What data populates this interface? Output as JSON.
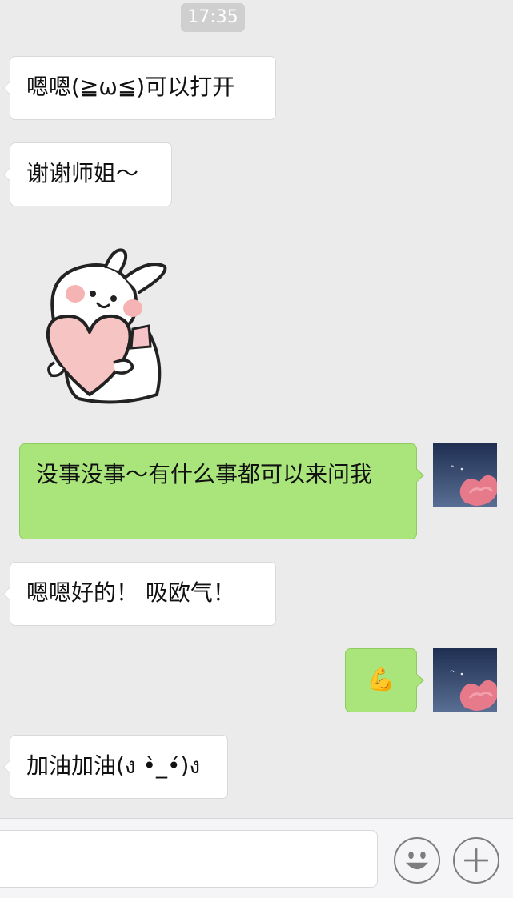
{
  "status": {
    "time": "17:35"
  },
  "messages": [
    {
      "side": "in",
      "text": "嗯嗯(≧ω≦)可以打开"
    },
    {
      "side": "in",
      "text": "谢谢师姐～"
    },
    {
      "side": "in",
      "type": "sticker",
      "icon": "bunny-holding-heart-sticker"
    },
    {
      "side": "out",
      "text": "没事没事～有什么事都可以来问我"
    },
    {
      "side": "in",
      "text": "嗯嗯好的！ 吸欧气！"
    },
    {
      "side": "out",
      "text": "💪"
    },
    {
      "side": "in",
      "text": "加油加油(ง •̀_•́)ง"
    }
  ],
  "input": {
    "value": "",
    "placeholder": ""
  },
  "icons": {
    "emoji_button": "smiley-face-icon",
    "more_button": "plus-icon"
  },
  "colors": {
    "background": "#ebebeb",
    "incoming_bubble": "#ffffff",
    "outgoing_bubble": "#a9e57a"
  }
}
